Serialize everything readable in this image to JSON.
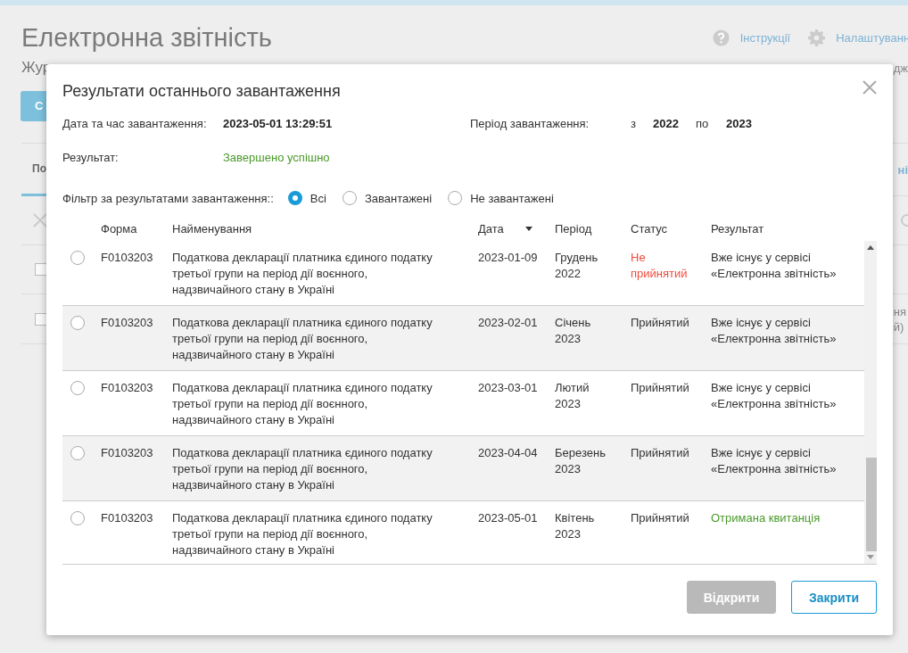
{
  "page": {
    "title": "Електронна звітність",
    "help_link": "Інструкції",
    "settings_link": "Налаштуванн",
    "journal_fragment": "Жур",
    "right_fragment": "дж",
    "button_fragment": "С",
    "tab_fragment": "По",
    "tab_right_fragment": "ні",
    "row_fragment_1": "ня",
    "row_fragment_2": "й)",
    "rows": [
      {
        "checked": false
      },
      {
        "checked": false
      }
    ]
  },
  "dialog": {
    "title": "Результати останнього завантаження",
    "info": {
      "datetime_label": "Дата та час завантаження:",
      "datetime": "2023-05-01 13:29:51",
      "period_label": "Період завантаження:",
      "from_label": "з",
      "from": "2022",
      "to_label": "по",
      "to": "2023",
      "result_label": "Результат:",
      "result": "Завершено успішно"
    },
    "filter": {
      "label": "Фільтр за результатами завантаження::",
      "options": [
        {
          "label": "Всі",
          "selected": true
        },
        {
          "label": "Завантажені",
          "selected": false
        },
        {
          "label": "Не завантажені",
          "selected": false
        }
      ]
    },
    "table": {
      "columns": [
        "Форма",
        "Найменування",
        "Дата",
        "Період",
        "Статус",
        "Результат"
      ],
      "rows": [
        {
          "selected": false,
          "form": "F0103203",
          "name": "Податкова декларації платника єдиного податку третьої групи на період дії воєнного, надзвичайного стану в Україні",
          "date": "2023-01-09",
          "period": "Грудень 2022",
          "status": {
            "text": "Не прийнятий",
            "color": "#f04b3c"
          },
          "result": {
            "text": "Вже існує у сервісі «Електронна звітність»",
            "color": "#333333"
          }
        },
        {
          "selected": false,
          "form": "F0103203",
          "name": "Податкова декларації платника єдиного податку третьої групи на період дії воєнного, надзвичайного стану в Україні",
          "date": "2023-02-01",
          "period": "Січень 2023",
          "status": {
            "text": "Прийнятий",
            "color": "#333333"
          },
          "result": {
            "text": "Вже існує у сервісі «Електронна звітність»",
            "color": "#333333"
          }
        },
        {
          "selected": false,
          "form": "F0103203",
          "name": "Податкова декларації платника єдиного податку третьої групи на період дії воєнного, надзвичайного стану в Україні",
          "date": "2023-03-01",
          "period": "Лютий 2023",
          "status": {
            "text": "Прийнятий",
            "color": "#333333"
          },
          "result": {
            "text": "Вже існує у сервісі «Електронна звітність»",
            "color": "#333333"
          }
        },
        {
          "selected": false,
          "form": "F0103203",
          "name": "Податкова декларації платника єдиного податку третьої групи на період дії воєнного, надзвичайного стану в Україні",
          "date": "2023-04-04",
          "period": "Березень 2023",
          "status": {
            "text": "Прийнятий",
            "color": "#333333"
          },
          "result": {
            "text": "Вже існує у сервісі «Електронна звітність»",
            "color": "#333333"
          }
        },
        {
          "selected": false,
          "form": "F0103203",
          "name": "Податкова декларації платника єдиного податку третьої групи на період дії воєнного, надзвичайного стану в Україні",
          "date": "2023-05-01",
          "period": "Квітень 2023",
          "status": {
            "text": "Прийнятий",
            "color": "#333333"
          },
          "result": {
            "text": "Отримана квитанція",
            "color": "#4a9a2a"
          }
        }
      ]
    },
    "buttons": [
      {
        "label": "Відкрити",
        "disabled": true
      },
      {
        "label": "Закрити",
        "disabled": false
      }
    ]
  }
}
